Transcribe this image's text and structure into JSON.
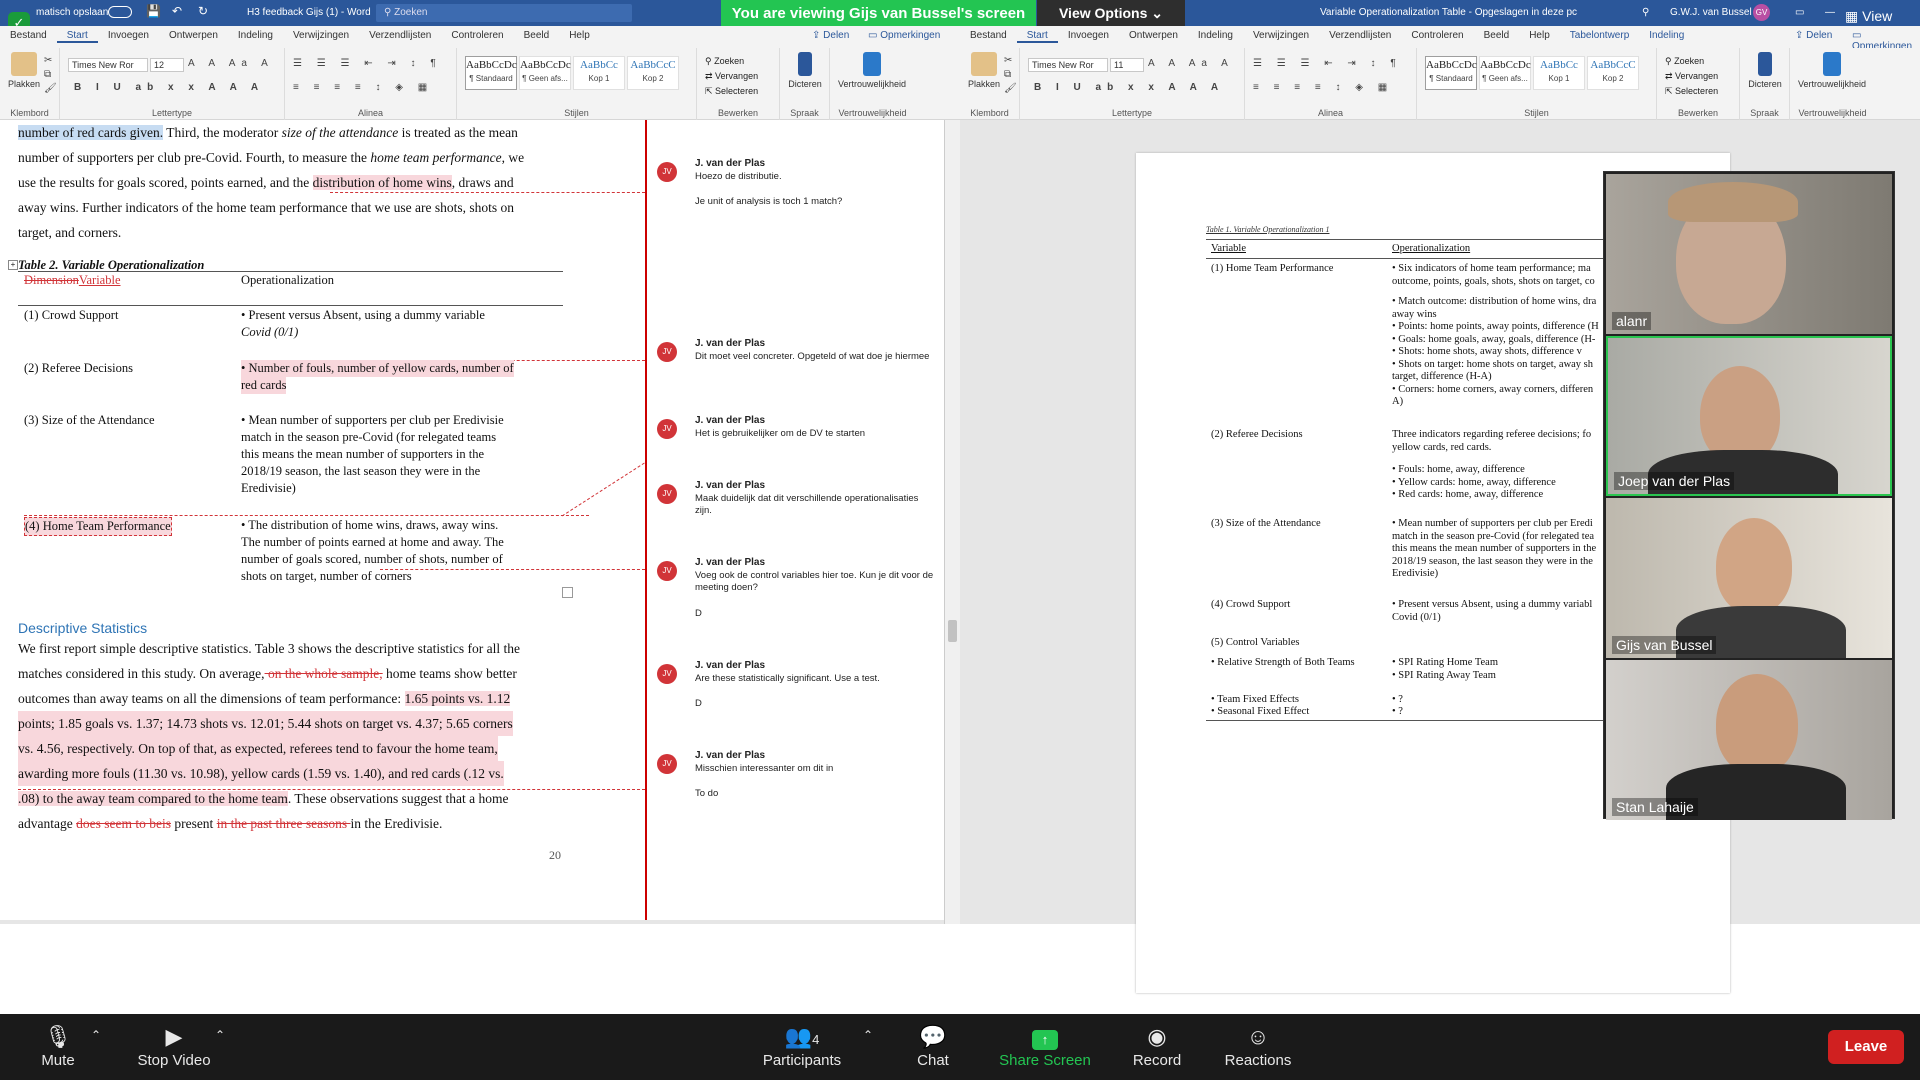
{
  "zoom": {
    "banner": "You are viewing Gijs van Bussel's screen",
    "view_options": "View Options",
    "view_label": "View",
    "toolbar": {
      "mute": "Mute",
      "stop_video": "Stop Video",
      "participants": "Participants",
      "participants_count": "4",
      "chat": "Chat",
      "share_screen": "Share Screen",
      "record": "Record",
      "reactions": "Reactions",
      "leave": "Leave"
    },
    "participants": [
      {
        "name": "alanr"
      },
      {
        "name": "Joep van der Plas"
      },
      {
        "name": "Gijs van Bussel"
      },
      {
        "name": "Stan Lahaije"
      }
    ]
  },
  "word_left": {
    "autosave": "matisch opslaan",
    "filename": "H3 feedback Gijs (1) - Word",
    "search": "Zoeken",
    "tabs": [
      "Bestand",
      "Start",
      "Invoegen",
      "Ontwerpen",
      "Indeling",
      "Verwijzingen",
      "Verzendlijsten",
      "Controleren",
      "Beeld",
      "Help"
    ],
    "share": "Delen",
    "comments": "Opmerkingen",
    "groups": {
      "clipboard": "Klembord",
      "font": "Lettertype",
      "paragraph": "Alinea",
      "styles": "Stijlen",
      "edit": "Bewerken",
      "speech": "Spraak",
      "privacy": "Vertrouwelijkheid"
    },
    "paste": "Plakken",
    "font_name": "Times New Ror",
    "font_size": "12",
    "styles": [
      {
        "preview": "AaBbCcDc",
        "name": "¶ Standaard"
      },
      {
        "preview": "AaBbCcDc",
        "name": "¶ Geen afs..."
      },
      {
        "preview": "AaBbCc",
        "name": "Kop 1"
      },
      {
        "preview": "AaBbCcC",
        "name": "Kop 2"
      }
    ],
    "find": "Zoeken",
    "replace": "Vervangen",
    "select": "Selecteren",
    "dictate": "Dicteren",
    "sensitivity": "Vertrouwelijkheid"
  },
  "word_right": {
    "filename": "Variable Operationalization Table  -  Opgeslagen in deze pc",
    "user": "G.W.J. van Bussel",
    "user_initials": "GV",
    "tabs": [
      "Bestand",
      "Start",
      "Invoegen",
      "Ontwerpen",
      "Indeling",
      "Verwijzingen",
      "Verzendlijsten",
      "Controleren",
      "Beeld",
      "Help",
      "Tabelontwerp",
      "Indeling"
    ],
    "share": "Delen",
    "comments": "Opmerkingen",
    "font_name": "Times New Ror",
    "font_size": "11"
  },
  "doc_left": {
    "p1_hl": "number of red cards given.",
    "p1_rest": " Third, the moderator ",
    "p1_it": "size of the attendance",
    "p1_end": " is treated as the mean",
    "p2_a": "number of supporters per club pre-Covid. Fourth, to measure the ",
    "p2_it": "home team performance",
    "p2_b": ", we",
    "p3_a": "use the results for goals scored, points earned, and the ",
    "p3_hl": "distribution of home wins",
    "p3_b": ", draws and",
    "p4": "away wins. Further indicators of the home team performance that we use are shots, shots on",
    "p5": "target, and corners.",
    "table_caption": "Table 2. Variable Operationalization",
    "col1_del": "Dimension",
    "col1_ins": "Variable",
    "col2": "Operationalization",
    "rows": [
      {
        "var": "(1) Crowd Support",
        "op": [
          "• Present versus Absent, using a dummy variable",
          "Covid (0/1)"
        ]
      },
      {
        "var": "(2) Referee Decisions",
        "op": [
          "• Number of fouls, number of yellow cards, number of",
          "red cards"
        ]
      },
      {
        "var": "(3) Size of the Attendance",
        "op": [
          "• Mean number of supporters per club per Eredivisie",
          "match in the season pre-Covid (for relegated teams",
          "this means the mean number of supporters in the",
          "2018/19 season, the last season they were in the",
          "Eredivisie)"
        ]
      },
      {
        "var": "(4) Home Team Performance",
        "op": [
          "• The distribution of home wins, draws, away wins.",
          "The number of points earned at home and away. The",
          "number of goals scored, number of shots, number of",
          "shots on target, number of corners"
        ]
      }
    ],
    "section": "Descriptive Statistics",
    "d1": "We first report simple descriptive statistics. Table 3 shows the descriptive statistics for all the",
    "d2_a": "matches considered in this study. On average,",
    "d2_del": " on the whole sample,",
    "d2_b": " home teams show better",
    "d3_a": "outcomes than away teams on all the dimensions of team performance: ",
    "d3_hl": "1.65 points vs. 1.12",
    "d4_hl": "points; 1.85 goals vs. 1.37; 14.73 shots vs. 12.01; 5.44 shots on target vs. 4.37; 5.65 corners",
    "d5_hl": "vs. 4.56, respectively. On top of that, as expected, referees tend to favour the home team,",
    "d6_hl": "awarding more fouls (11.30 vs. 10.98), yellow cards (1.59 vs. 1.40), and red cards (.12 vs.",
    "d7_hl": ".08) to the away team compared to the home team",
    "d7_b": ". These observations suggest that a home",
    "d8_a": "advantage ",
    "d8_del1": "does seem to beis",
    "d8_b": " present ",
    "d8_del2": "in the past three seasons ",
    "d8_c": "in the Eredivisie.",
    "page": "20"
  },
  "comments": [
    {
      "author": "J. van der Plas",
      "initials": "JV",
      "text": "Hoezo de distributie.",
      "extra": "Je unit of analysis is toch 1 match?"
    },
    {
      "author": "J. van der Plas",
      "initials": "JV",
      "text": "Dit moet veel concreter. Opgeteld of wat doe je hiermee",
      "extra": ""
    },
    {
      "author": "J. van der Plas",
      "initials": "JV",
      "text": "Het is gebruikelijker om de DV te starten",
      "extra": ""
    },
    {
      "author": "J. van der Plas",
      "initials": "JV",
      "text": "Maak duidelijk dat dit verschillende operationalisaties zijn.",
      "extra": ""
    },
    {
      "author": "J. van der Plas",
      "initials": "JV",
      "text": "Voeg ook de control variables hier toe. Kun je dit voor de meeting doen?",
      "extra": "D"
    },
    {
      "author": "J. van der Plas",
      "initials": "JV",
      "text": "Are these statistically significant. Use a test.",
      "extra": "D"
    },
    {
      "author": "J. van der Plas",
      "initials": "JV",
      "text": "Misschien interessanter om dit in",
      "extra": "To do"
    }
  ],
  "doc_right": {
    "caption": "Table 1. Variable Operationalization 1",
    "col1": "Variable",
    "col2": "Operationalization",
    "rows": [
      {
        "var": "(1) Home Team Performance",
        "op": [
          "•  Six indicators of home team performance; ma",
          "outcome, points, goals, shots, shots on target, co",
          "",
          "• Match outcome: distribution of home wins, dra",
          "away wins",
          "• Points: home points, away points, difference (H",
          "• Goals: home goals, away, goals, difference (H-",
          "• Shots: home shots, away shots, difference v",
          "• Shots on target: home shots on target, away sh",
          "target, difference (H-A)",
          "• Corners: home corners, away corners, differen",
          "A)"
        ]
      },
      {
        "var": "(2) Referee Decisions",
        "op": [
          "Three indicators regarding referee decisions; fo",
          "yellow cards, red cards.",
          "",
          "• Fouls: home, away, difference",
          "• Yellow cards: home, away, difference",
          "• Red cards: home, away, difference"
        ]
      },
      {
        "var": "(3) Size of the Attendance",
        "op": [
          "• Mean number of supporters per club per Eredi",
          "match in the season pre-Covid (for relegated tea",
          "this means the mean number of supporters in the",
          "2018/19 season, the last season they were in the",
          "Eredivisie)"
        ]
      },
      {
        "var": "(4) Crowd Support",
        "op": [
          "•  Present versus Absent, using a dummy variabl",
          "Covid (0/1)"
        ]
      },
      {
        "var": "(5) Control Variables",
        "op": [
          ""
        ]
      },
      {
        "var": "• Relative Strength of Both Teams",
        "op": [
          "• SPI Rating Home Team",
          "• SPI Rating Away Team"
        ]
      },
      {
        "var": "• Team Fixed Effects",
        "op": [
          "• ?"
        ]
      },
      {
        "var": "• Seasonal Fixed Effect",
        "op": [
          "• ?"
        ]
      }
    ]
  },
  "colors": {
    "word_blue": "#2b579a",
    "zoom_green": "#23c552",
    "comment_red": "#d13438",
    "leave_red": "#d02020"
  }
}
